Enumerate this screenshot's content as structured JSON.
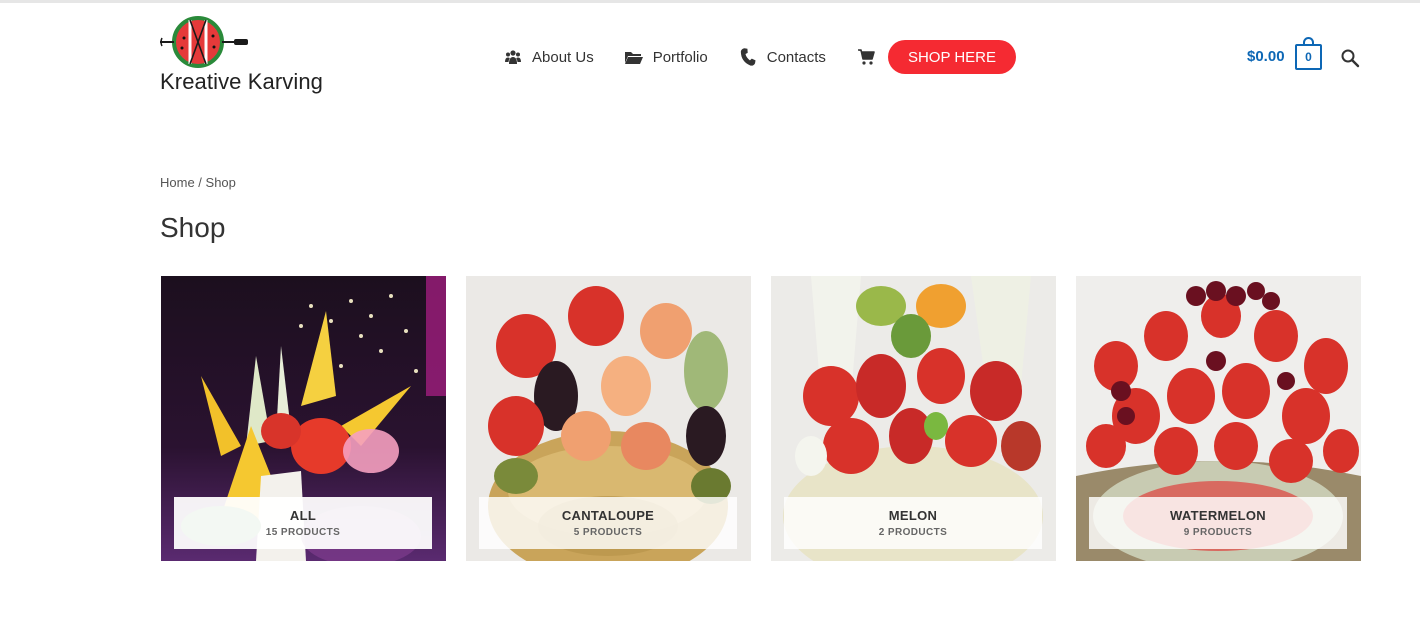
{
  "site": {
    "name": "Kreative Karving"
  },
  "nav": {
    "items": [
      {
        "label": "About Us",
        "icon": "group-icon"
      },
      {
        "label": "Portfolio",
        "icon": "folder-icon"
      },
      {
        "label": "Contacts",
        "icon": "phone-icon"
      }
    ],
    "cart_icon": "cart-icon",
    "cta_label": "SHOP HERE"
  },
  "header_cart": {
    "total": "$0.00",
    "count": "0"
  },
  "breadcrumb": {
    "home": "Home",
    "separator": " / ",
    "current": "Shop"
  },
  "page": {
    "title": "Shop"
  },
  "categories": [
    {
      "name": "ALL",
      "count": "15 PRODUCTS"
    },
    {
      "name": "CANTALOUPE",
      "count": "5 PRODUCTS"
    },
    {
      "name": "MELON",
      "count": "2 PRODUCTS"
    },
    {
      "name": "WATERMELON",
      "count": "9 PRODUCTS"
    }
  ],
  "colors": {
    "accent": "#f52a32",
    "cart_blue": "#0d67b5",
    "text": "#3a3a3a"
  }
}
